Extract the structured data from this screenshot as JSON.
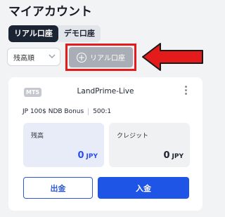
{
  "page": {
    "title": "マイアカウント"
  },
  "account_tabs": [
    {
      "label": "リアル口座",
      "active": true
    },
    {
      "label": "デモ口座",
      "active": false
    }
  ],
  "sort": {
    "selected": "残高順"
  },
  "add_account": {
    "label": "リアル口座",
    "icon": "plus-circle-icon"
  },
  "account_card": {
    "platform_badge": "MT5",
    "server": "LandPrime-Live",
    "account_type": "JP 100$ NDB Bonus",
    "leverage": "500:1",
    "balance": {
      "label": "残高",
      "value": "0",
      "unit": "JPY"
    },
    "credit": {
      "label": "クレジット",
      "value": "0",
      "unit": "JPY"
    },
    "withdraw_label": "出金",
    "deposit_label": "入金"
  },
  "colors": {
    "accent_blue": "#1f55e6",
    "highlight_red": "#e31b1b",
    "dark_tab": "#1b2433"
  }
}
